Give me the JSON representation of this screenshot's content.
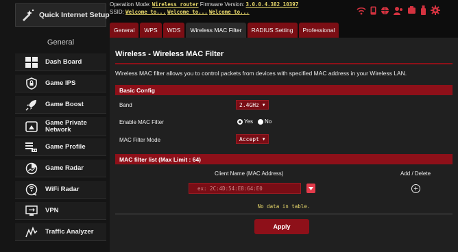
{
  "sidebar": {
    "quick_setup_label": "Quick Internet Setup",
    "general_heading": "General",
    "items": [
      {
        "label": "Dash Board",
        "icon": "dashboard-icon"
      },
      {
        "label": "Game IPS",
        "icon": "shield-icon"
      },
      {
        "label": "Game Boost",
        "icon": "rocket-icon"
      },
      {
        "label": "Game Private Network",
        "icon": "private-network-icon"
      },
      {
        "label": "Game Profile",
        "icon": "profile-icon"
      },
      {
        "label": "Game Radar",
        "icon": "radar-icon"
      },
      {
        "label": "WiFi Radar",
        "icon": "wifi-radar-icon"
      },
      {
        "label": "VPN",
        "icon": "vpn-icon"
      },
      {
        "label": "Traffic Analyzer",
        "icon": "traffic-analyzer-icon"
      }
    ]
  },
  "status": {
    "op_mode_label": "Operation Mode:",
    "op_mode_value": "Wireless router",
    "fw_label": "Firmware Version:",
    "fw_value": "3.0.0.4.382_10397",
    "ssid_label": "SSID:",
    "ssid_values": [
      "Welcome to...",
      "Welcome to...",
      "Welcome to..."
    ]
  },
  "tabs": [
    "General",
    "WPS",
    "WDS",
    "Wireless MAC Filter",
    "RADIUS Setting",
    "Professional"
  ],
  "active_tab": "Wireless MAC Filter",
  "page": {
    "title": "Wireless - Wireless MAC Filter",
    "description": "Wireless MAC filter allows you to control packets from devices with specified MAC address in your Wireless LAN.",
    "basic_config_heading": "Basic Config",
    "band_label": "Band",
    "band_value": "2.4GHz",
    "enable_label": "Enable MAC Filter",
    "enable_yes": "Yes",
    "enable_no": "No",
    "enable_selected": "Yes",
    "mode_label": "MAC Filter Mode",
    "mode_value": "Accept",
    "list_heading": "MAC filter list (Max Limit : 64)",
    "col_client": "Client Name (MAC Address)",
    "col_add_delete": "Add / Delete",
    "mac_placeholder": "ex: 2C:4D:54:E8:64:E0",
    "no_data": "No data in table.",
    "apply_label": "Apply"
  },
  "colors": {
    "accent": "#8e1019",
    "select_bg": "#790d15",
    "highlight_text": "#e6d66a",
    "panel_bg": "#202020"
  }
}
